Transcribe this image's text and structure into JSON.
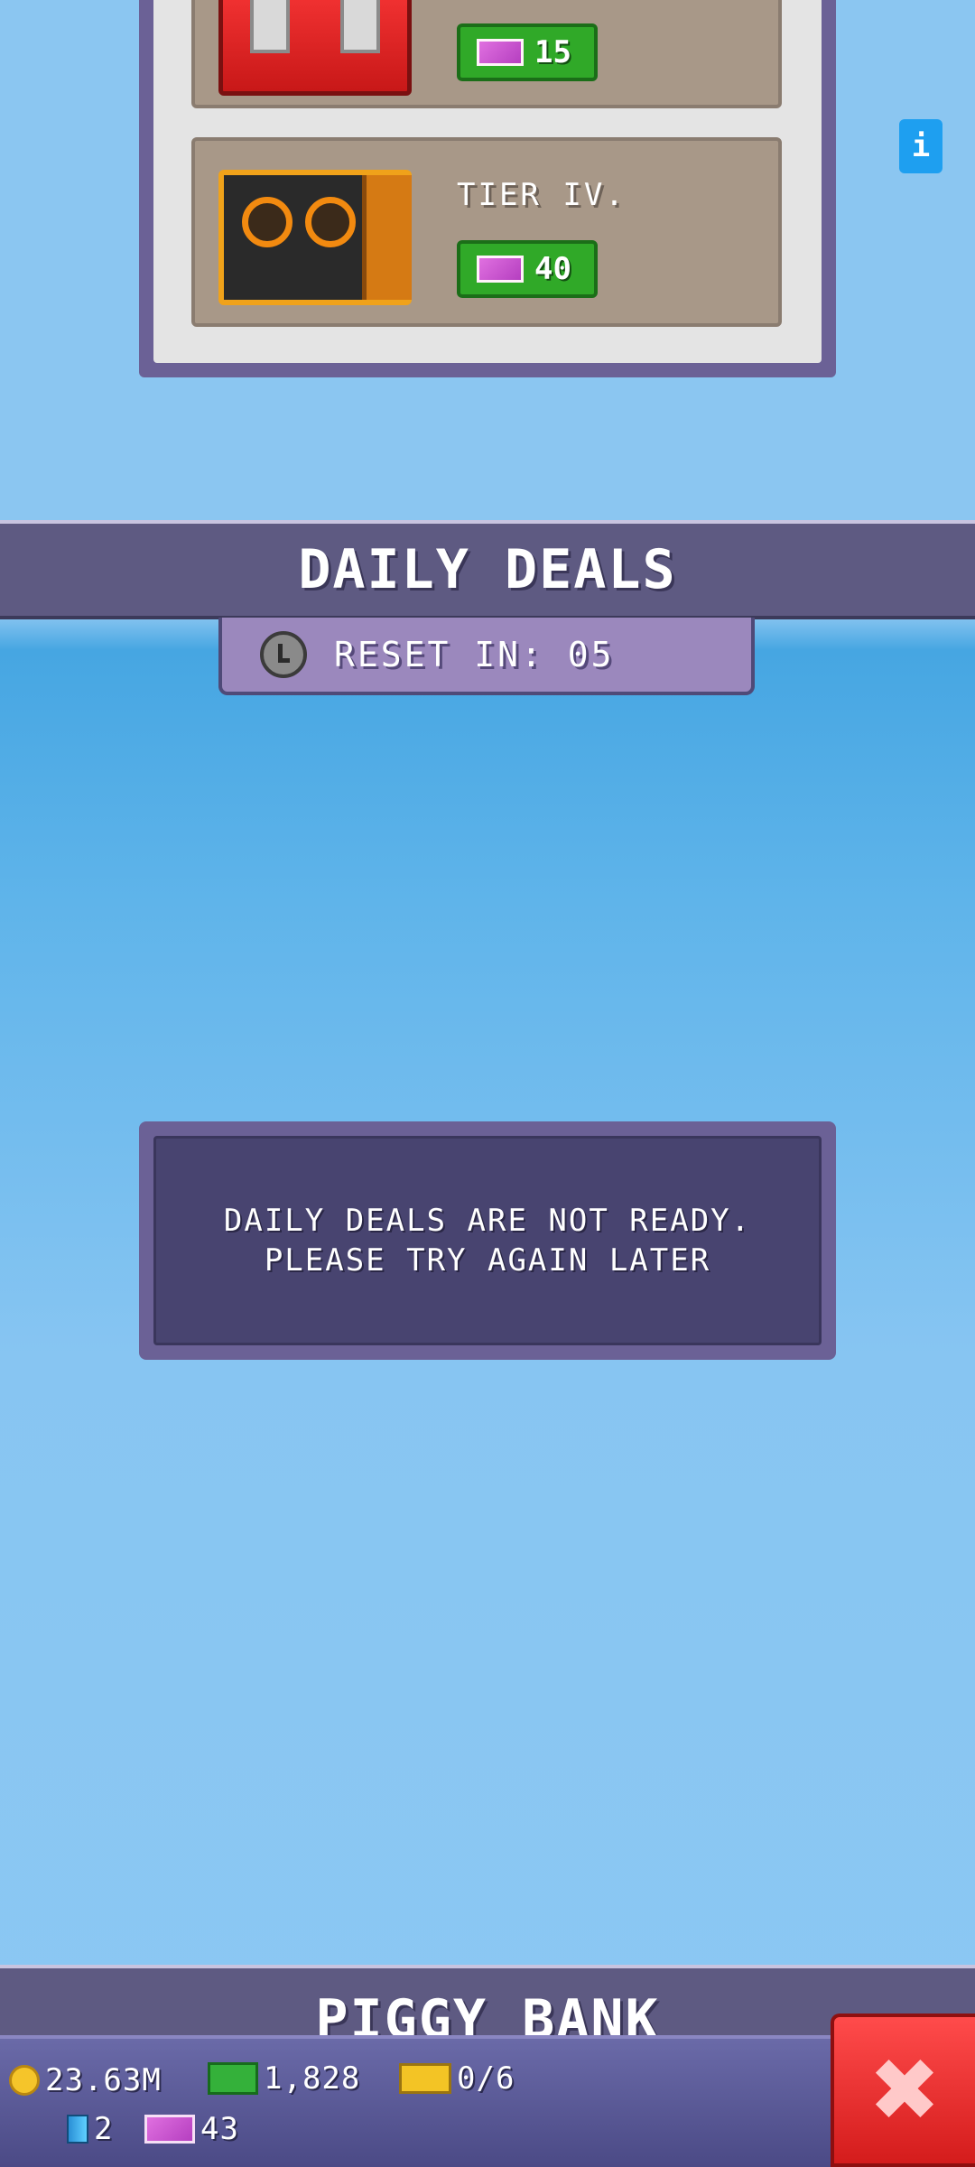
{
  "shop": {
    "tiers": [
      {
        "label": "",
        "price": "15",
        "currency_icon": "ticket-icon",
        "color": "#e01f1f"
      },
      {
        "label": "TIER IV.",
        "price": "40",
        "currency_icon": "ticket-icon",
        "color": "#2a2a2a"
      }
    ],
    "info_label": "i"
  },
  "daily_deals": {
    "title": "DAILY DEALS",
    "reset_text": "RESET IN: 05",
    "message_line1": "DAILY DEALS ARE NOT READY.",
    "message_line2": "PLEASE TRY AGAIN LATER"
  },
  "piggy_bank": {
    "title": "PIGGY BANK"
  },
  "resources": {
    "coins": "23.63M",
    "cash": "1,828",
    "gold": "0/6",
    "gems": "2",
    "tickets": "43"
  },
  "colors": {
    "accent_purple": "#5e5a82",
    "price_green": "#30a928",
    "close_red": "#e82525"
  }
}
